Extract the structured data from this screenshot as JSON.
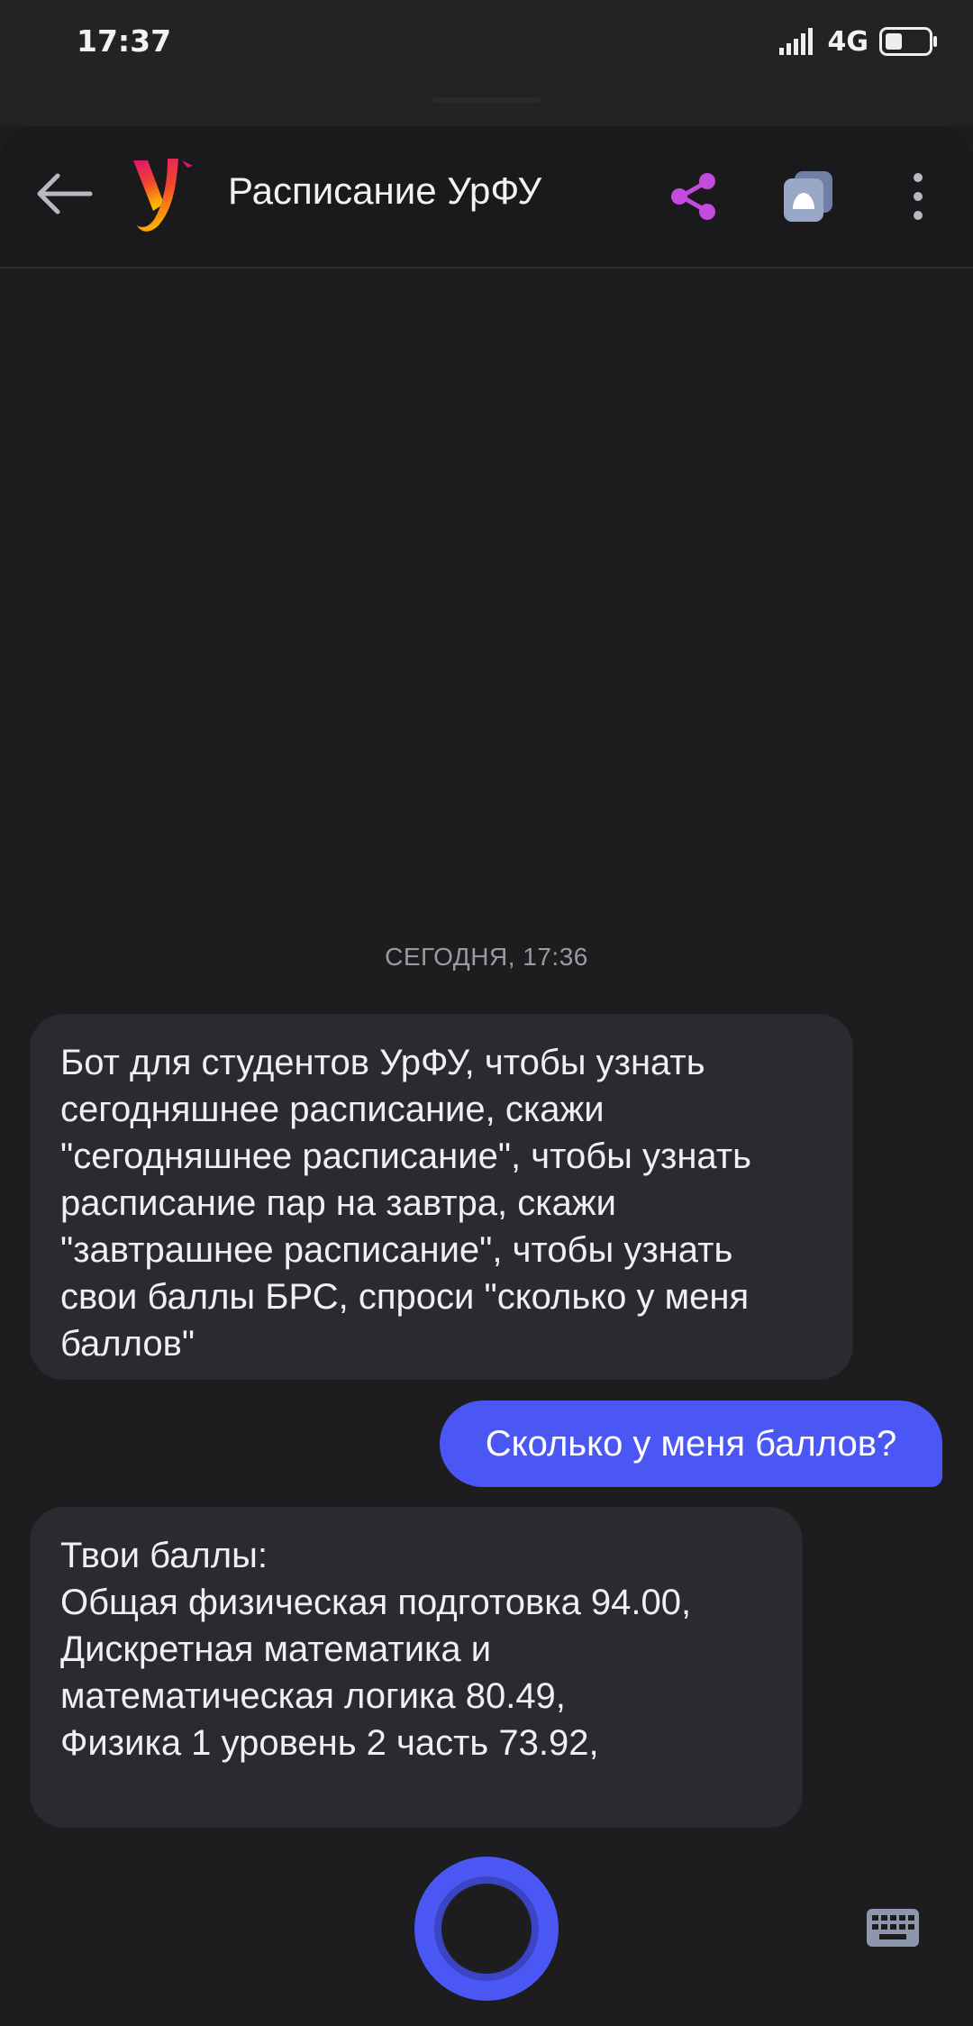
{
  "status_bar": {
    "time": "17:37",
    "network": "4G",
    "icons": [
      "signal-icon",
      "battery-icon"
    ]
  },
  "header": {
    "title": "Расписание УрФУ",
    "icons": [
      "back-arrow-icon",
      "app-logo",
      "share-icon",
      "alice-icon",
      "more-vertical-icon"
    ],
    "share_color": "#c54be0"
  },
  "chat": {
    "date_stamp": "СЕГОДНЯ, 17:36",
    "messages": [
      {
        "from": "bot",
        "text": "Бот для студентов УрФУ, чтобы узнать\nсегодняшнее расписание, скажи\n\"сегодняшнее расписание\", чтобы узнать\nрасписание пар на завтра, скажи\n\"завтрашнее расписание\", чтобы узнать\nсвои баллы БРС, спроси \"сколько у меня\nбаллов\""
      },
      {
        "from": "user",
        "text": "Сколько у меня баллов?"
      },
      {
        "from": "bot",
        "text": "Твои баллы:\nОбщая физическая подготовка 94.00,\nДискретная математика и\nматематическая логика 80.49,\nФизика 1 уровень 2 часть 73.92,"
      }
    ]
  },
  "bottom_bar": {
    "icons": [
      "alice-voice-button",
      "keyboard-icon"
    ],
    "accent": "#4b57f5"
  }
}
